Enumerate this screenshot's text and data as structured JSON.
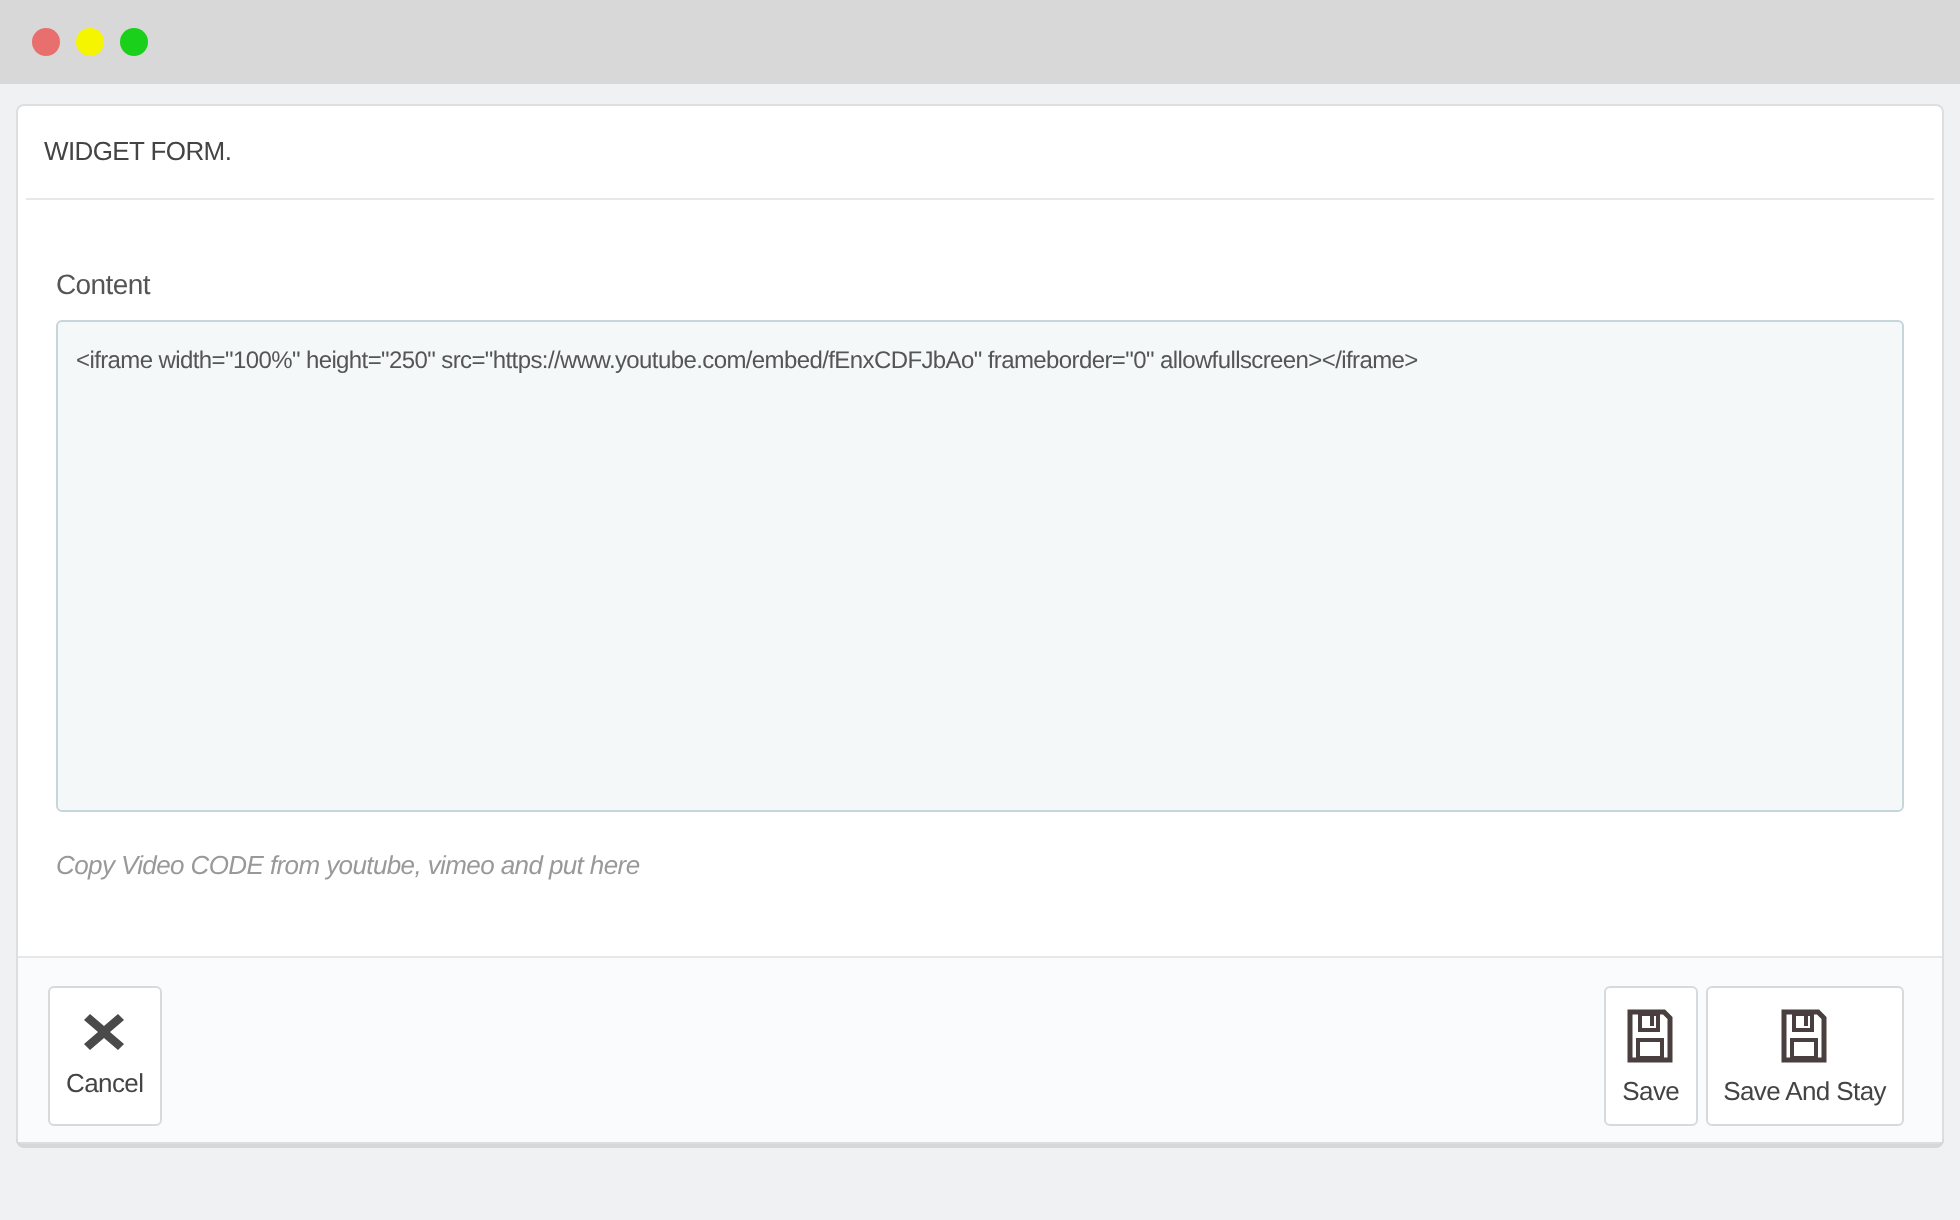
{
  "window": {
    "controls": [
      {
        "color": "#e96e6e"
      },
      {
        "color": "#f5f500"
      },
      {
        "color": "#1ad01a"
      }
    ]
  },
  "panel": {
    "title": "WIDGET FORM.",
    "field": {
      "label": "Content",
      "value": "<iframe width=\"100%\" height=\"250\" src=\"https://www.youtube.com/embed/fEnxCDFJbAo\" frameborder=\"0\" allowfullscreen></iframe>",
      "help": "Copy Video CODE from youtube, vimeo and put here"
    },
    "footer": {
      "left": [
        {
          "kind": "cancel",
          "label": "Cancel"
        }
      ],
      "right": [
        {
          "kind": "save",
          "label": "Save"
        },
        {
          "kind": "save",
          "label": "Save And Stay"
        }
      ]
    }
  }
}
